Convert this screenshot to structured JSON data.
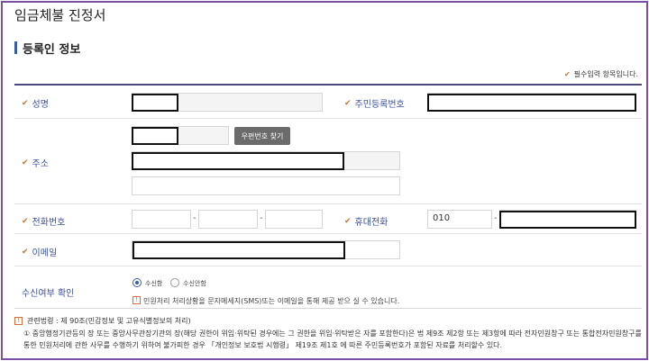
{
  "page": {
    "title": "임금체불 진정서"
  },
  "section": {
    "title": "등록인 정보"
  },
  "required_note": "필수입력 항목입니다.",
  "fields": {
    "name": {
      "label": "성명"
    },
    "resident_number": {
      "label": "주민등록번호"
    },
    "address": {
      "label": "주소",
      "postcode_button": "우편번호 찾기"
    },
    "phone": {
      "label": "전화번호",
      "separator": "-"
    },
    "mobile": {
      "label": "휴대전화",
      "prefix": "010",
      "separator": "-"
    },
    "email": {
      "label": "이메일"
    },
    "receive": {
      "label": "수신여부 확인",
      "options": [
        "수신함",
        "수신안함"
      ],
      "selected": "수신함",
      "info": "민원처리 처리상황을 문자메세지(SMS)또는 이메일을 통해 제공 받으 실 수 있습니다."
    }
  },
  "law": {
    "title": "관련법령 : 제 90조(민감정보 및 고유식별정보의 처리)",
    "line1": "① 중앙행정기관등의 장 또는 중앙사무관장기관의 장(해당 권한이 위임·위탁된 경우에는 그 권한을 위임·위탁받은 자를 포함한다)은 법 제9조 제2항 또는 제3항에 따라 전자민원창구 또는 통합전자민원창구를",
    "line2": "통한 민원처리에 관한 사무를 수행하기 위하여 불가피한 경우 「개인정보 보호법 시행령」 제19조 제1호 에 따른 주민등록번호가 포함된 자료를 처리할수 있다."
  },
  "colors": {
    "accent": "#3a5ba8",
    "check": "#c8742d",
    "frame": "#7a4fa8"
  },
  "icons": {
    "check": "check-icon",
    "info": "info-icon"
  }
}
